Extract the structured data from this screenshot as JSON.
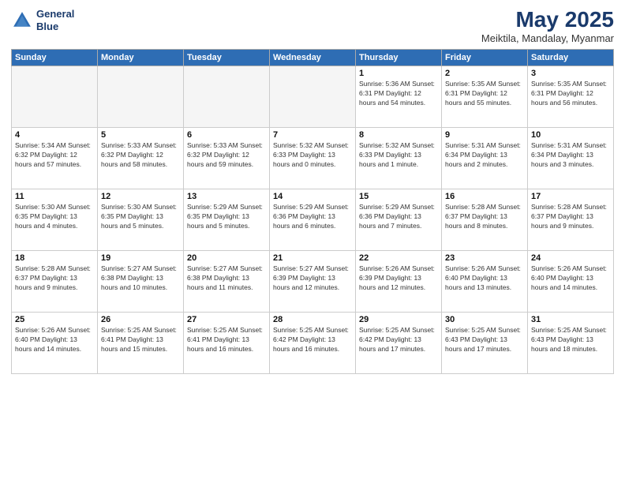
{
  "header": {
    "logo_line1": "General",
    "logo_line2": "Blue",
    "month_title": "May 2025",
    "subtitle": "Meiktila, Mandalay, Myanmar"
  },
  "weekdays": [
    "Sunday",
    "Monday",
    "Tuesday",
    "Wednesday",
    "Thursday",
    "Friday",
    "Saturday"
  ],
  "weeks": [
    [
      {
        "day": "",
        "info": "",
        "empty": true
      },
      {
        "day": "",
        "info": "",
        "empty": true
      },
      {
        "day": "",
        "info": "",
        "empty": true
      },
      {
        "day": "",
        "info": "",
        "empty": true
      },
      {
        "day": "1",
        "info": "Sunrise: 5:36 AM\nSunset: 6:31 PM\nDaylight: 12 hours\nand 54 minutes."
      },
      {
        "day": "2",
        "info": "Sunrise: 5:35 AM\nSunset: 6:31 PM\nDaylight: 12 hours\nand 55 minutes."
      },
      {
        "day": "3",
        "info": "Sunrise: 5:35 AM\nSunset: 6:31 PM\nDaylight: 12 hours\nand 56 minutes."
      }
    ],
    [
      {
        "day": "4",
        "info": "Sunrise: 5:34 AM\nSunset: 6:32 PM\nDaylight: 12 hours\nand 57 minutes."
      },
      {
        "day": "5",
        "info": "Sunrise: 5:33 AM\nSunset: 6:32 PM\nDaylight: 12 hours\nand 58 minutes."
      },
      {
        "day": "6",
        "info": "Sunrise: 5:33 AM\nSunset: 6:32 PM\nDaylight: 12 hours\nand 59 minutes."
      },
      {
        "day": "7",
        "info": "Sunrise: 5:32 AM\nSunset: 6:33 PM\nDaylight: 13 hours\nand 0 minutes."
      },
      {
        "day": "8",
        "info": "Sunrise: 5:32 AM\nSunset: 6:33 PM\nDaylight: 13 hours\nand 1 minute."
      },
      {
        "day": "9",
        "info": "Sunrise: 5:31 AM\nSunset: 6:34 PM\nDaylight: 13 hours\nand 2 minutes."
      },
      {
        "day": "10",
        "info": "Sunrise: 5:31 AM\nSunset: 6:34 PM\nDaylight: 13 hours\nand 3 minutes."
      }
    ],
    [
      {
        "day": "11",
        "info": "Sunrise: 5:30 AM\nSunset: 6:35 PM\nDaylight: 13 hours\nand 4 minutes."
      },
      {
        "day": "12",
        "info": "Sunrise: 5:30 AM\nSunset: 6:35 PM\nDaylight: 13 hours\nand 5 minutes."
      },
      {
        "day": "13",
        "info": "Sunrise: 5:29 AM\nSunset: 6:35 PM\nDaylight: 13 hours\nand 5 minutes."
      },
      {
        "day": "14",
        "info": "Sunrise: 5:29 AM\nSunset: 6:36 PM\nDaylight: 13 hours\nand 6 minutes."
      },
      {
        "day": "15",
        "info": "Sunrise: 5:29 AM\nSunset: 6:36 PM\nDaylight: 13 hours\nand 7 minutes."
      },
      {
        "day": "16",
        "info": "Sunrise: 5:28 AM\nSunset: 6:37 PM\nDaylight: 13 hours\nand 8 minutes."
      },
      {
        "day": "17",
        "info": "Sunrise: 5:28 AM\nSunset: 6:37 PM\nDaylight: 13 hours\nand 9 minutes."
      }
    ],
    [
      {
        "day": "18",
        "info": "Sunrise: 5:28 AM\nSunset: 6:37 PM\nDaylight: 13 hours\nand 9 minutes."
      },
      {
        "day": "19",
        "info": "Sunrise: 5:27 AM\nSunset: 6:38 PM\nDaylight: 13 hours\nand 10 minutes."
      },
      {
        "day": "20",
        "info": "Sunrise: 5:27 AM\nSunset: 6:38 PM\nDaylight: 13 hours\nand 11 minutes."
      },
      {
        "day": "21",
        "info": "Sunrise: 5:27 AM\nSunset: 6:39 PM\nDaylight: 13 hours\nand 12 minutes."
      },
      {
        "day": "22",
        "info": "Sunrise: 5:26 AM\nSunset: 6:39 PM\nDaylight: 13 hours\nand 12 minutes."
      },
      {
        "day": "23",
        "info": "Sunrise: 5:26 AM\nSunset: 6:40 PM\nDaylight: 13 hours\nand 13 minutes."
      },
      {
        "day": "24",
        "info": "Sunrise: 5:26 AM\nSunset: 6:40 PM\nDaylight: 13 hours\nand 14 minutes."
      }
    ],
    [
      {
        "day": "25",
        "info": "Sunrise: 5:26 AM\nSunset: 6:40 PM\nDaylight: 13 hours\nand 14 minutes."
      },
      {
        "day": "26",
        "info": "Sunrise: 5:25 AM\nSunset: 6:41 PM\nDaylight: 13 hours\nand 15 minutes."
      },
      {
        "day": "27",
        "info": "Sunrise: 5:25 AM\nSunset: 6:41 PM\nDaylight: 13 hours\nand 16 minutes."
      },
      {
        "day": "28",
        "info": "Sunrise: 5:25 AM\nSunset: 6:42 PM\nDaylight: 13 hours\nand 16 minutes."
      },
      {
        "day": "29",
        "info": "Sunrise: 5:25 AM\nSunset: 6:42 PM\nDaylight: 13 hours\nand 17 minutes."
      },
      {
        "day": "30",
        "info": "Sunrise: 5:25 AM\nSunset: 6:43 PM\nDaylight: 13 hours\nand 17 minutes."
      },
      {
        "day": "31",
        "info": "Sunrise: 5:25 AM\nSunset: 6:43 PM\nDaylight: 13 hours\nand 18 minutes."
      }
    ]
  ]
}
